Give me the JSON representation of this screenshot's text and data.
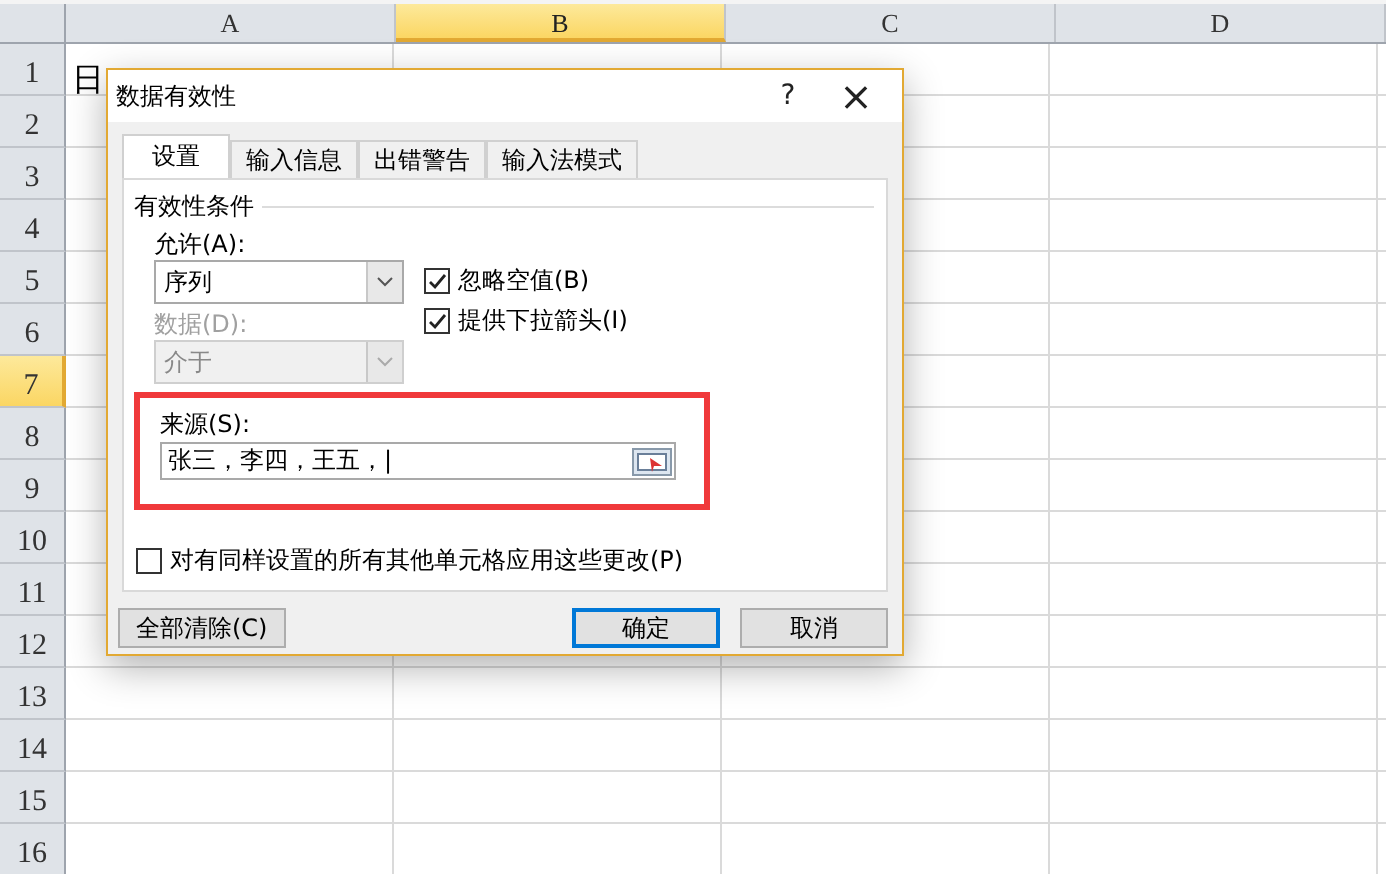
{
  "sheet": {
    "columns": [
      {
        "label": "A",
        "selected": false
      },
      {
        "label": "B",
        "selected": true
      },
      {
        "label": "C",
        "selected": false
      },
      {
        "label": "D",
        "selected": false
      }
    ],
    "rows": [
      {
        "label": "1",
        "selected": false,
        "cells": [
          "日"
        ]
      },
      {
        "label": "2",
        "selected": false
      },
      {
        "label": "3",
        "selected": false
      },
      {
        "label": "4",
        "selected": false
      },
      {
        "label": "5",
        "selected": false
      },
      {
        "label": "6",
        "selected": false
      },
      {
        "label": "7",
        "selected": true
      },
      {
        "label": "8",
        "selected": false
      },
      {
        "label": "9",
        "selected": false
      },
      {
        "label": "10",
        "selected": false
      },
      {
        "label": "11",
        "selected": false
      },
      {
        "label": "12",
        "selected": false
      },
      {
        "label": "13",
        "selected": false
      },
      {
        "label": "14",
        "selected": false
      },
      {
        "label": "15",
        "selected": false
      },
      {
        "label": "16",
        "selected": false
      }
    ]
  },
  "dialog": {
    "title": "数据有效性",
    "help": "?",
    "close": "×",
    "tabs": [
      {
        "label": "设置",
        "selected": true
      },
      {
        "label": "输入信息",
        "selected": false
      },
      {
        "label": "出错警告",
        "selected": false
      },
      {
        "label": "输入法模式",
        "selected": false
      }
    ],
    "group_title": "有效性条件",
    "allow": {
      "label": "允许(A):",
      "value": "序列",
      "disabled": false
    },
    "data": {
      "label": "数据(D):",
      "value": "介于",
      "disabled": true
    },
    "checks": [
      {
        "label": "忽略空值(B)",
        "checked": true
      },
      {
        "label": "提供下拉箭头(I)",
        "checked": true
      }
    ],
    "source": {
      "label": "来源(S):",
      "value": "张三，李四，王五，|",
      "highlighted": true
    },
    "apply_all": {
      "label": "对有同样设置的所有其他单元格应用这些更改(P)",
      "checked": false
    },
    "buttons": [
      {
        "label": "全部清除(C)",
        "default": false
      },
      {
        "label": "确定",
        "default": true
      },
      {
        "label": "取消",
        "default": false
      }
    ]
  }
}
